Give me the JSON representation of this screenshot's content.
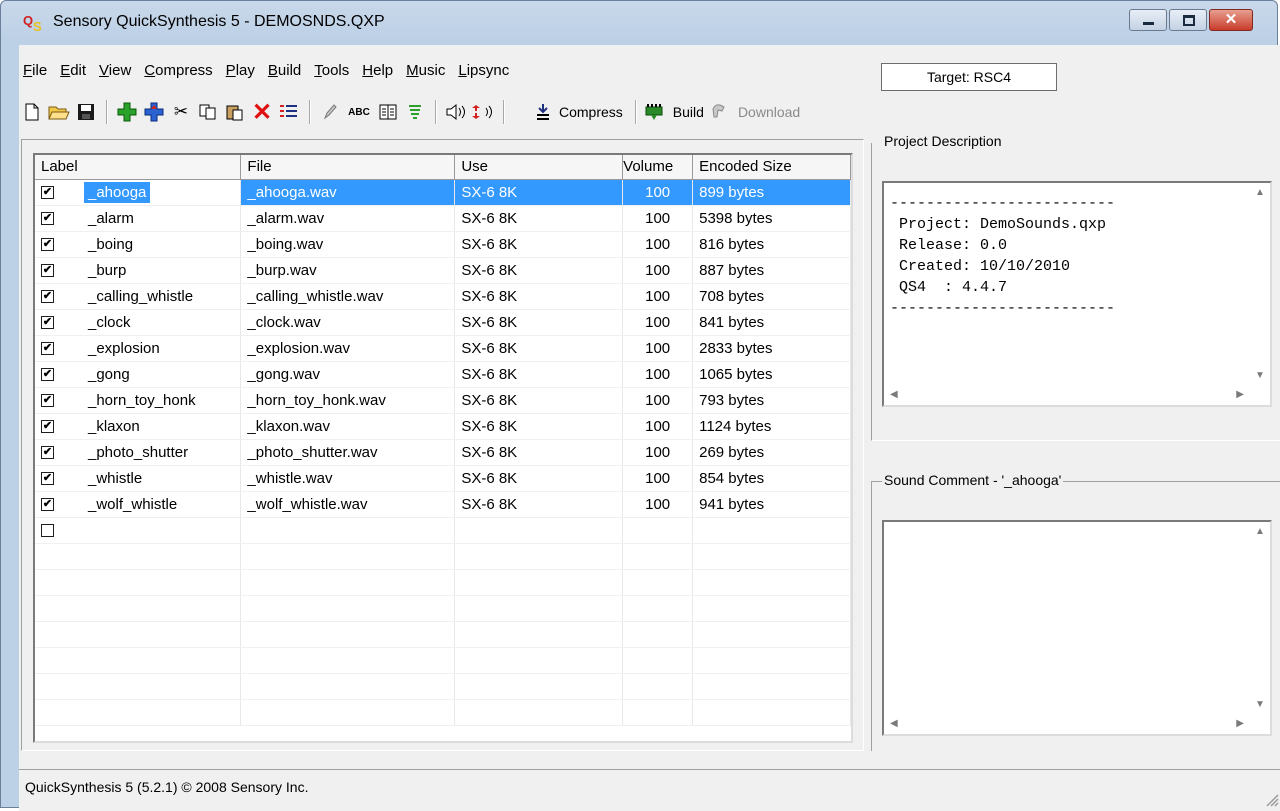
{
  "window": {
    "title": "Sensory QuickSynthesis 5 - DEMOSNDS.QXP",
    "icon_letters": "QS",
    "close_glyph": "✕"
  },
  "menu": [
    "File",
    "Edit",
    "View",
    "Compress",
    "Play",
    "Build",
    "Tools",
    "Help",
    "Music",
    "Lipsync"
  ],
  "menu_underlines": [
    "F",
    "E",
    "V",
    "C",
    "P",
    "B",
    "T",
    "H",
    "M",
    "L"
  ],
  "target": "Target: RSC4",
  "toolbar": {
    "compress_label": "Compress",
    "build_label": "Build",
    "download_label": "Download"
  },
  "list": {
    "columns": [
      "Label",
      "File",
      "Use",
      "Volume",
      "Encoded Size"
    ],
    "rows": [
      {
        "checked": true,
        "label": "_ahooga",
        "file": "_ahooga.wav",
        "use": "SX-6  8K",
        "volume": "100",
        "size": "899 bytes"
      },
      {
        "checked": true,
        "label": "_alarm",
        "file": "_alarm.wav",
        "use": "SX-6  8K",
        "volume": "100",
        "size": "5398 bytes"
      },
      {
        "checked": true,
        "label": "_boing",
        "file": "_boing.wav",
        "use": "SX-6  8K",
        "volume": "100",
        "size": "816 bytes"
      },
      {
        "checked": true,
        "label": "_burp",
        "file": "_burp.wav",
        "use": "SX-6  8K",
        "volume": "100",
        "size": "887 bytes"
      },
      {
        "checked": true,
        "label": "_calling_whistle",
        "file": "_calling_whistle.wav",
        "use": "SX-6  8K",
        "volume": "100",
        "size": "708 bytes"
      },
      {
        "checked": true,
        "label": "_clock",
        "file": "_clock.wav",
        "use": "SX-6  8K",
        "volume": "100",
        "size": "841 bytes"
      },
      {
        "checked": true,
        "label": "_explosion",
        "file": "_explosion.wav",
        "use": "SX-6  8K",
        "volume": "100",
        "size": "2833 bytes"
      },
      {
        "checked": true,
        "label": "_gong",
        "file": "_gong.wav",
        "use": "SX-6  8K",
        "volume": "100",
        "size": "1065 bytes"
      },
      {
        "checked": true,
        "label": "_horn_toy_honk",
        "file": "_horn_toy_honk.wav",
        "use": "SX-6  8K",
        "volume": "100",
        "size": "793 bytes"
      },
      {
        "checked": true,
        "label": "_klaxon",
        "file": "_klaxon.wav",
        "use": "SX-6  8K",
        "volume": "100",
        "size": "1124 bytes"
      },
      {
        "checked": true,
        "label": "_photo_shutter",
        "file": "_photo_shutter.wav",
        "use": "SX-6  8K",
        "volume": "100",
        "size": "269 bytes"
      },
      {
        "checked": true,
        "label": "_whistle",
        "file": "_whistle.wav",
        "use": "SX-6  8K",
        "volume": "100",
        "size": "854 bytes"
      },
      {
        "checked": true,
        "label": "_wolf_whistle",
        "file": "_wolf_whistle.wav",
        "use": "SX-6  8K",
        "volume": "100",
        "size": "941 bytes"
      },
      {
        "checked": false,
        "label": "",
        "file": "",
        "use": "",
        "volume": "",
        "size": ""
      }
    ],
    "selected_index": 0
  },
  "project_description": {
    "caption": "Project Description",
    "text": "-------------------------\n Project: DemoSounds.qxp\n Release: 0.0\n Created: 10/10/2010\n QS4  : 4.4.7\n-------------------------"
  },
  "sound_comment": {
    "caption": "Sound Comment - '_ahooga'",
    "text": ""
  },
  "status": "QuickSynthesis 5 (5.2.1) © 2008 Sensory Inc.",
  "colors": {
    "selection": "#3399ff",
    "title_bg": "#c9d8ea",
    "client_bg": "#f0f0f0"
  }
}
